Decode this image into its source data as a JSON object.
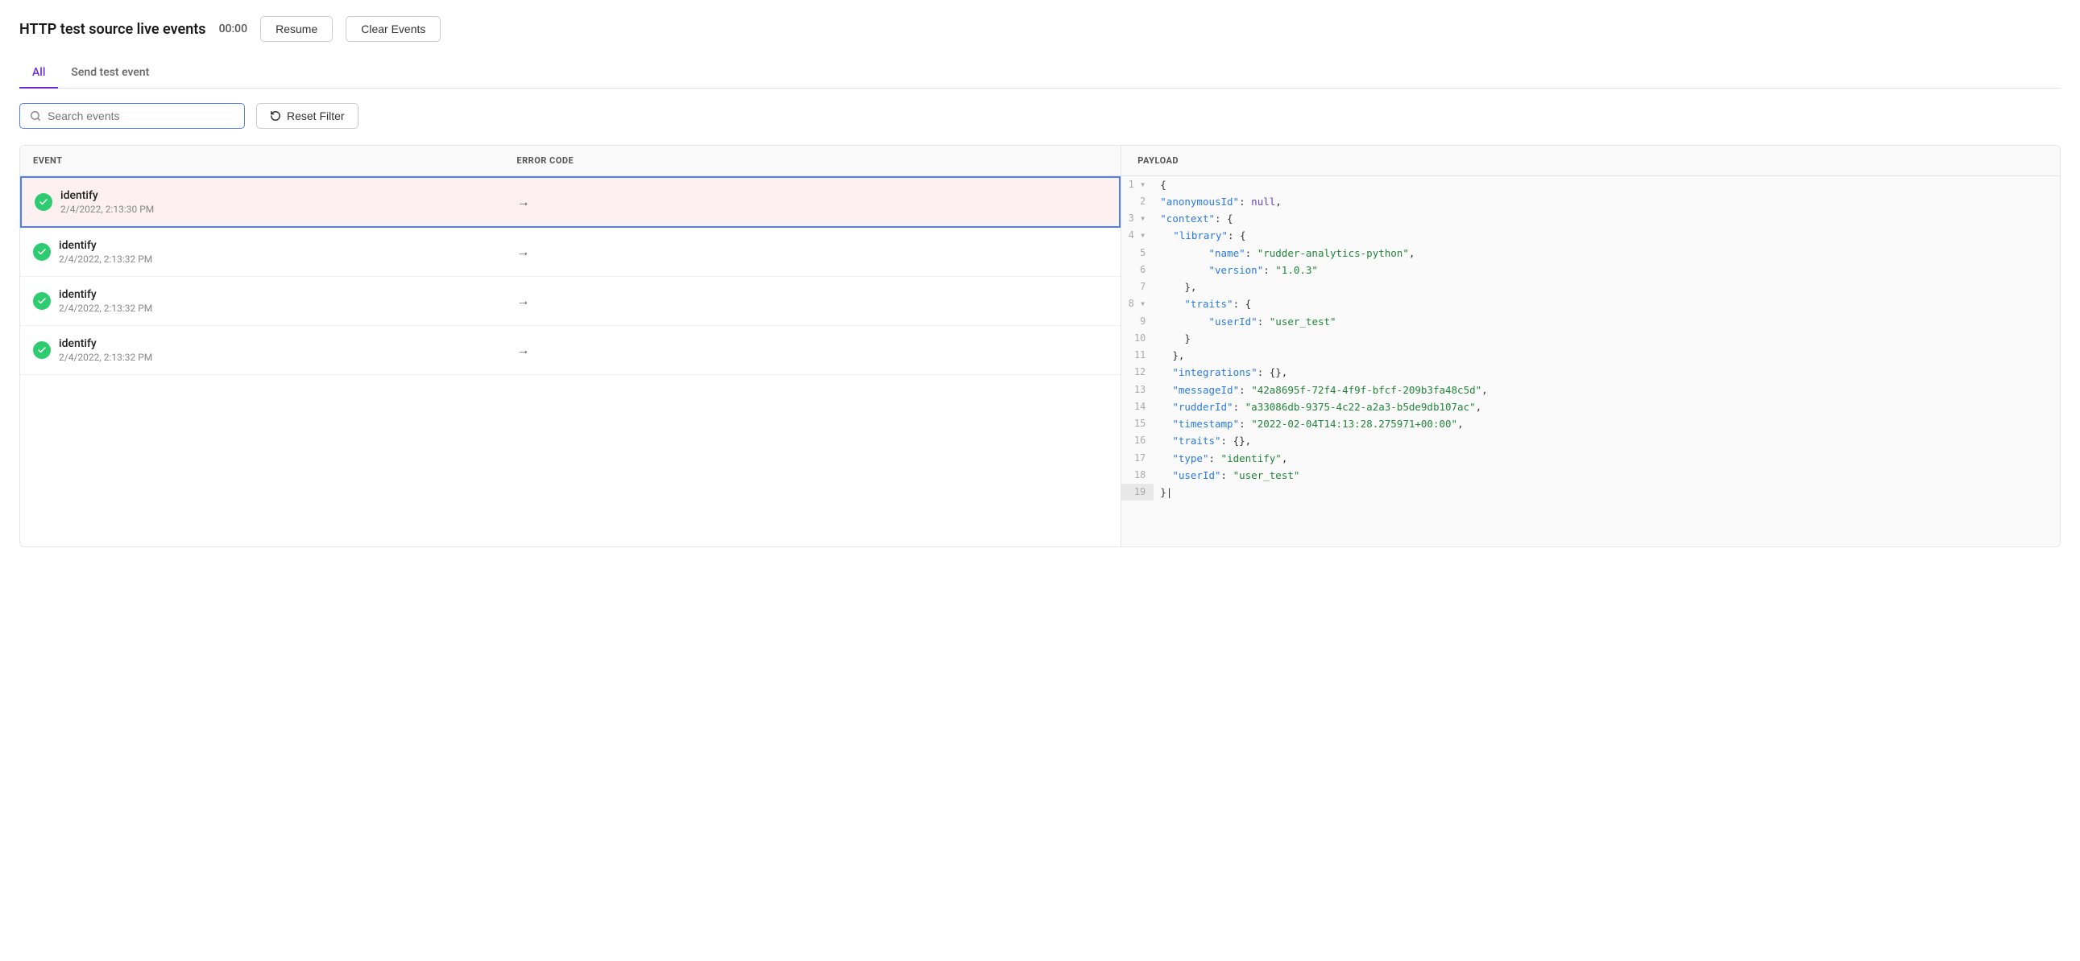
{
  "header": {
    "title": "HTTP test source live events",
    "timer": "00:00",
    "resume_label": "Resume",
    "clear_events_label": "Clear Events"
  },
  "tabs": [
    {
      "id": "all",
      "label": "All",
      "active": true
    },
    {
      "id": "send-test",
      "label": "Send test event",
      "active": false
    }
  ],
  "search": {
    "placeholder": "Search events",
    "value": ""
  },
  "reset_filter_label": "Reset Filter",
  "table": {
    "col_event": "EVENT",
    "col_error": "ERROR CODE",
    "rows": [
      {
        "id": 1,
        "name": "identify",
        "time": "2/4/2022, 2:13:30 PM",
        "selected": true
      },
      {
        "id": 2,
        "name": "identify",
        "time": "2/4/2022, 2:13:32 PM",
        "selected": false
      },
      {
        "id": 3,
        "name": "identify",
        "time": "2/4/2022, 2:13:32 PM",
        "selected": false
      },
      {
        "id": 4,
        "name": "identify",
        "time": "2/4/2022, 2:13:32 PM",
        "selected": false
      }
    ]
  },
  "payload": {
    "header": "PAYLOAD",
    "lines": [
      {
        "num": 1,
        "content": "{"
      },
      {
        "num": 2,
        "content": "  \"anonymousId\": null,"
      },
      {
        "num": 3,
        "content": "  \"context\": {"
      },
      {
        "num": 4,
        "content": "    \"library\": {"
      },
      {
        "num": 5,
        "content": "      \"name\": \"rudder-analytics-python\","
      },
      {
        "num": 6,
        "content": "      \"version\": \"1.0.3\""
      },
      {
        "num": 7,
        "content": "    },"
      },
      {
        "num": 8,
        "content": "    \"traits\": {"
      },
      {
        "num": 9,
        "content": "      \"userId\": \"user_test\""
      },
      {
        "num": 10,
        "content": "    }"
      },
      {
        "num": 11,
        "content": "  },"
      },
      {
        "num": 12,
        "content": "  \"integrations\": {},"
      },
      {
        "num": 13,
        "content": "  \"messageId\": \"42a8695f-72f4-4f9f-bfcf-209b3fa48c5d\","
      },
      {
        "num": 14,
        "content": "  \"rudderId\": \"a33086db-9375-4c22-a2a3-b5de9db107ac\","
      },
      {
        "num": 15,
        "content": "  \"timestamp\": \"2022-02-04T14:13:28.275971+00:00\","
      },
      {
        "num": 16,
        "content": "  \"traits\": {},"
      },
      {
        "num": 17,
        "content": "  \"type\": \"identify\","
      },
      {
        "num": 18,
        "content": "  \"userId\": \"user_test\""
      },
      {
        "num": 19,
        "content": "}|"
      }
    ]
  }
}
